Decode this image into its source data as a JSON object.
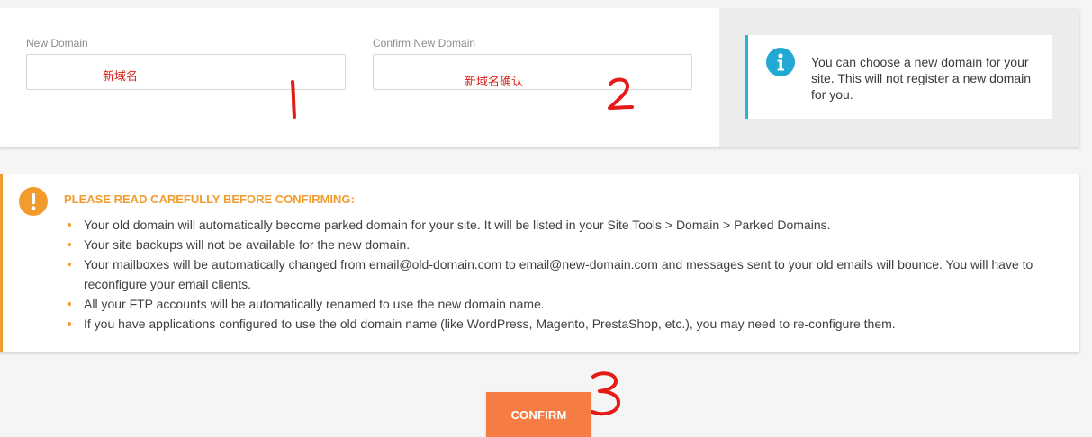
{
  "form": {
    "new_domain": {
      "label": "New Domain",
      "value": ""
    },
    "confirm_domain": {
      "label": "Confirm New Domain",
      "value": ""
    }
  },
  "annotations": {
    "handwritten_1": "新域名",
    "handwritten_2": "新域名确认",
    "marker_color": "#e41b17"
  },
  "info": {
    "icon": "info-icon",
    "text": "You can choose a new domain for your site. This will not register a new domain for you.",
    "accent_color": "#2bb3d2"
  },
  "warning": {
    "icon": "exclamation-icon",
    "title": "PLEASE READ CAREFULLY BEFORE CONFIRMING:",
    "accent_color": "#f39c2e",
    "items": [
      "Your old domain will automatically become parked domain for your site. It will be listed in your Site Tools > Domain > Parked Domains.",
      "Your site backups will not be available for the new domain.",
      "Your mailboxes will be automatically changed from email@old-domain.com to email@new-domain.com and messages sent to your old emails will bounce. You will have to reconfigure your email clients.",
      "All your FTP accounts will be automatically renamed to use the new domain name.",
      "If you have applications configured to use the old domain name (like WordPress, Magento, PrestaShop, etc.), you may need to re-configure them."
    ]
  },
  "actions": {
    "confirm_label": "CONFIRM",
    "confirm_color": "#f57c43"
  }
}
